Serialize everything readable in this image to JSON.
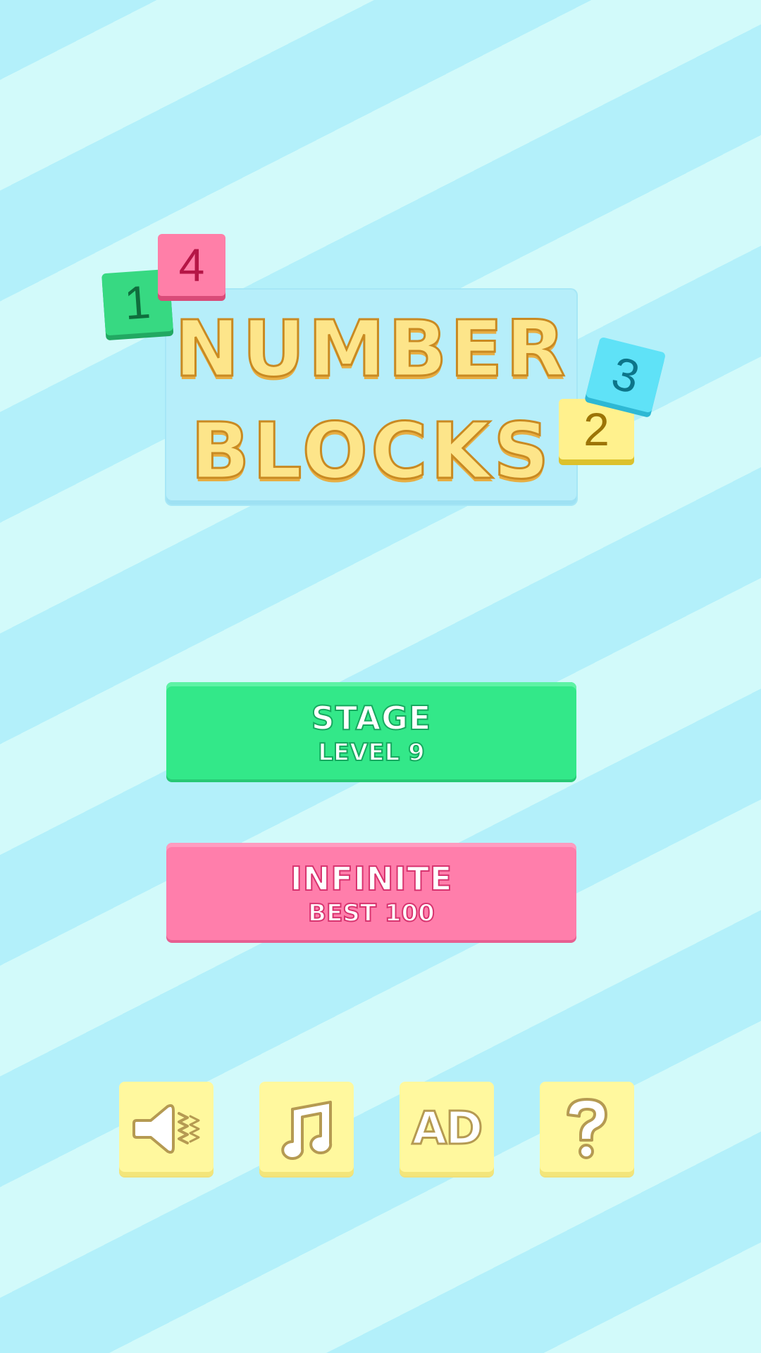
{
  "logo": {
    "line1": "NUMBER",
    "line2": "BLOCKS",
    "tiles": [
      "1",
      "4",
      "3",
      "2"
    ]
  },
  "buttons": {
    "stage": {
      "title": "STAGE",
      "subtitle": "LEVEL 9"
    },
    "infinite": {
      "title": "INFINITE",
      "subtitle": "BEST 100"
    }
  },
  "icon_buttons": {
    "sound": "speaker-icon",
    "music": "music-note-icon",
    "ad": "AD",
    "help": "question-mark-icon"
  },
  "colors": {
    "stage": "#33e889",
    "infinite": "#ff7eab",
    "icon_button": "#fff89e",
    "logo_text": "#fde58a",
    "background_light": "#d2fafa",
    "background_dark": "#b3f0fa"
  }
}
